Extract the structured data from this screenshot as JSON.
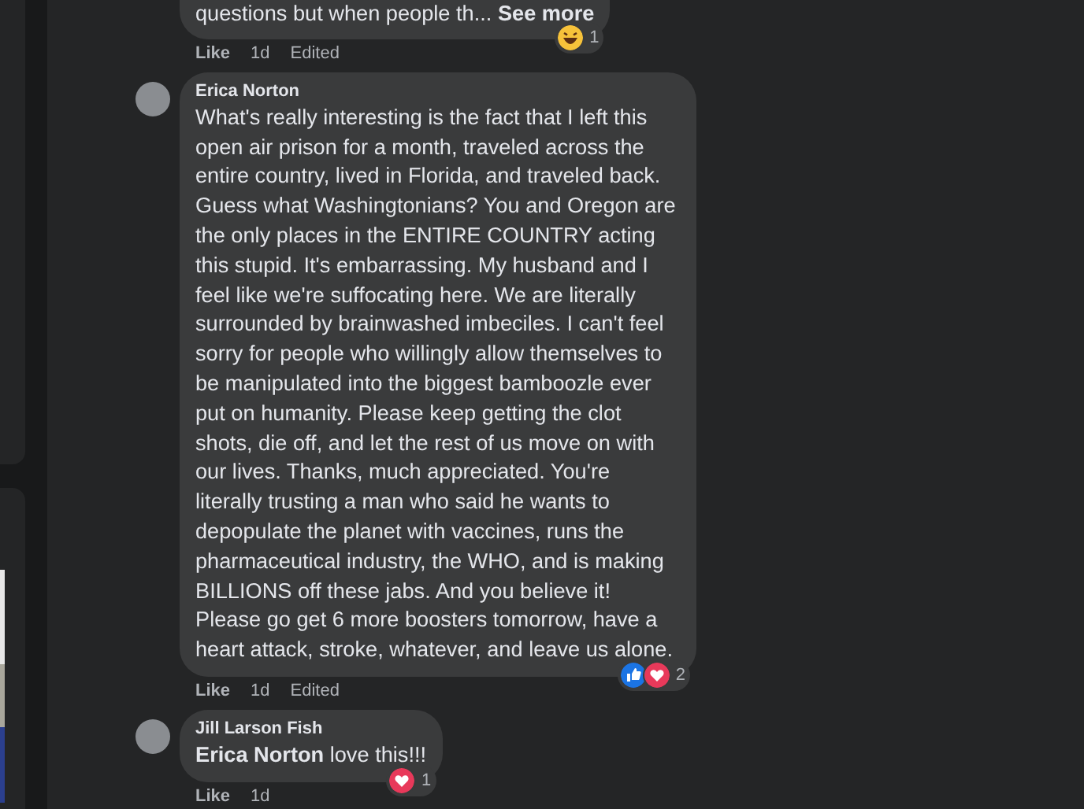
{
  "comments": [
    {
      "text": "questions but when people th...",
      "see_more": "See more",
      "reactions": [
        {
          "kind": "haha"
        }
      ],
      "reaction_count": "1",
      "actions": [
        "Like",
        "1d",
        "Edited"
      ]
    },
    {
      "author": "Erica Norton",
      "text": "What's really interesting is the fact that I left this open air prison for a month, traveled across the entire country, lived in Florida, and traveled back. Guess what Washingtonians? You and Oregon are the only places in the ENTIRE COUNTRY acting this stupid. It's embarrassing. My husband and I feel like we're suffocating here. We are literally surrounded by brainwashed imbeciles. I can't feel sorry for people who willingly allow themselves to be manipulated into the biggest bamboozle ever put on humanity. Please keep getting the clot shots, die off, and let the rest of us move on with our lives. Thanks, much appreciated. You're literally trusting a man who said he wants to depopulate the planet with vaccines, runs the pharmaceutical industry, the WHO, and is making BILLIONS off these jabs. And you believe it! Please go get 6 more boosters tomorrow, have a heart attack, stroke, whatever, and leave us alone.",
      "reactions": [
        {
          "kind": "like"
        },
        {
          "kind": "love"
        }
      ],
      "reaction_count": "2",
      "actions": [
        "Like",
        "1d",
        "Edited"
      ]
    },
    {
      "author": "Jill Larson Fish",
      "text": "**Erica Norton** love this!!!",
      "reactions": [
        {
          "kind": "love"
        }
      ],
      "reaction_count": "1",
      "actions": [
        "Like",
        "1d"
      ]
    }
  ]
}
